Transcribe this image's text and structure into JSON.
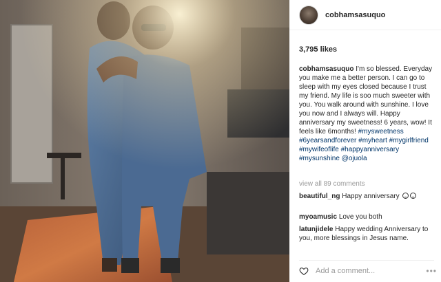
{
  "post": {
    "username": "cobhamsasuquo",
    "likes": "3,795 likes",
    "caption_user": "cobhamsasuquo",
    "caption_text": "I'm so blessed. Everyday you make me a better person. I can go to sleep with my eyes closed because I trust my friend. My life is soo much sweeter with you. You walk around with sunshine. I love you now and I always will. Happy anniversary my sweetness! 6 years, wow! It feels like 6months!",
    "caption_tags": "#mysweetness #6yearsandforever #myheart #mygirlfriend #mywifeoflife #happyanniversary #mysunshine @ojuola",
    "view_all": "view all 89 comments"
  },
  "comments": [
    {
      "user": "beautiful_ng",
      "text": "Happy anniversary"
    },
    {
      "user": "myoamusic",
      "text": "Love you both"
    },
    {
      "user": "latunjidele",
      "text": "Happy wedding Anniversary to you, more blessings in Jesus name."
    }
  ],
  "add_comment": {
    "placeholder": "Add a comment..."
  },
  "icons": {
    "avatar": "profile-avatar",
    "heart": "heart-icon",
    "more": "more-options-icon"
  }
}
